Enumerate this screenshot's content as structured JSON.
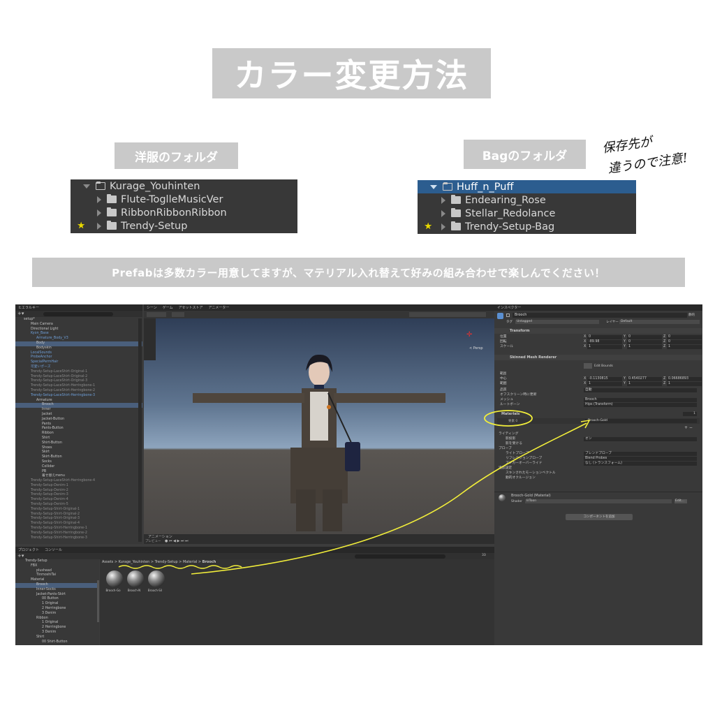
{
  "title": "カラー変更方法",
  "left_folder_label": "洋服のフォルダ",
  "right_folder_label": "Bagのフォルダ",
  "hand_note": [
    "保存先が",
    "違うので注意!"
  ],
  "left_folder": {
    "root": "Kurage_Youhinten",
    "children": [
      "Flute-ToglleMusicVer",
      "RibbonRibbonRibbon",
      "Trendy-Setup"
    ]
  },
  "right_folder": {
    "root": "Huff_n_Puff",
    "children": [
      "Endearing_Rose",
      "Stellar_Redolance",
      "Trendy-Setup-Bag"
    ]
  },
  "banner": "Prefabは多数カラー用意してますが、マテリアル入れ替えて好みの組み合わせで楽しんでください！",
  "unity": {
    "hierarchy_tab": "ヒエラルキー",
    "scene_tabs": [
      "シーン",
      "ゲーム",
      "アセットストア",
      "アニメーター"
    ],
    "inspector_tab": "インスペクター",
    "hierarchy": [
      {
        "t": "setup*",
        "c": ""
      },
      {
        "t": "Main Camera",
        "c": ""
      },
      {
        "t": "Directional Light",
        "c": ""
      },
      {
        "t": "Kyon_Base",
        "c": "blue"
      },
      {
        "t": "Armature_Body_V3",
        "c": "blue"
      },
      {
        "t": "Body",
        "c": "sel"
      },
      {
        "t": "Bodyskin",
        "c": ""
      },
      {
        "t": "LocalSounds",
        "c": "blue"
      },
      {
        "t": "ProbeAnchor",
        "c": "blue"
      },
      {
        "t": "SpecialPermHair",
        "c": "blue"
      },
      {
        "t": "可愛いポーズ",
        "c": "blue"
      },
      {
        "t": "Trendy-Setup-LaceShirt-Original-1",
        "c": "dim"
      },
      {
        "t": "Trendy-Setup-LaceShirt-Original-2",
        "c": "dim"
      },
      {
        "t": "Trendy-Setup-LaceShirt-Original-3",
        "c": "dim"
      },
      {
        "t": "Trendy-Setup-LaceShirt-Herringbone-1",
        "c": "dim"
      },
      {
        "t": "Trendy-Setup-LaceShirt-Herringbone-2",
        "c": "dim"
      },
      {
        "t": "Trendy-Setup-LaceShirt-Herringbone-3",
        "c": "blue"
      },
      {
        "t": "Armature",
        "c": ""
      },
      {
        "t": "Brooch",
        "c": "sel"
      },
      {
        "t": "Inner",
        "c": ""
      },
      {
        "t": "Jacket",
        "c": ""
      },
      {
        "t": "Jacket-Button",
        "c": ""
      },
      {
        "t": "Pants",
        "c": ""
      },
      {
        "t": "Pants-Button",
        "c": ""
      },
      {
        "t": "Ribbon",
        "c": ""
      },
      {
        "t": "Shirt",
        "c": ""
      },
      {
        "t": "Shirt-Button",
        "c": ""
      },
      {
        "t": "Shoes",
        "c": ""
      },
      {
        "t": "Skirt",
        "c": ""
      },
      {
        "t": "Skirt-Button",
        "c": ""
      },
      {
        "t": "Socks",
        "c": ""
      },
      {
        "t": "Collider",
        "c": ""
      },
      {
        "t": "PB",
        "c": ""
      },
      {
        "t": "着せ替えmenu",
        "c": ""
      },
      {
        "t": "Trendy-Setup-LaceShirt-Herringbone-4",
        "c": "dim"
      },
      {
        "t": "Trendy-Setup-Denim-1",
        "c": "dim"
      },
      {
        "t": "Trendy-Setup-Denim-2",
        "c": "dim"
      },
      {
        "t": "Trendy-Setup-Denim-3",
        "c": "dim"
      },
      {
        "t": "Trendy-Setup-Denim-4",
        "c": "dim"
      },
      {
        "t": "Trendy-Setup-Denim-5",
        "c": "dim"
      },
      {
        "t": "Trendy-Setup-Shirt-Original-1",
        "c": "dim"
      },
      {
        "t": "Trendy-Setup-Shirt-Original-2",
        "c": "dim"
      },
      {
        "t": "Trendy-Setup-Shirt-Original-3",
        "c": "dim"
      },
      {
        "t": "Trendy-Setup-Shirt-Original-4",
        "c": "dim"
      },
      {
        "t": "Trendy-Setup-Shirt-Herringbone-1",
        "c": "dim"
      },
      {
        "t": "Trendy-Setup-Shirt-Herringbone-2",
        "c": "dim"
      },
      {
        "t": "Trendy-Setup-Shirt-Herringbone-3",
        "c": "dim"
      }
    ],
    "project_tabs": [
      "プロジェクト",
      "コンソール"
    ],
    "project_tree": [
      {
        "t": "Trendy-Setup",
        "d": 0
      },
      {
        "t": "FBX",
        "d": 1
      },
      {
        "t": "plushead",
        "d": 2
      },
      {
        "t": "TinmoshiTai",
        "d": 2
      },
      {
        "t": "Material",
        "d": 1
      },
      {
        "t": "Brooch",
        "d": 2,
        "sel": true
      },
      {
        "t": "Inner-Socks",
        "d": 2
      },
      {
        "t": "Jacket-Pants-Skirt",
        "d": 2
      },
      {
        "t": "00 Button",
        "d": 3
      },
      {
        "t": "1 Original",
        "d": 3
      },
      {
        "t": "2 Herringbone",
        "d": 3
      },
      {
        "t": "3 Denim",
        "d": 3
      },
      {
        "t": "Ribbon",
        "d": 2
      },
      {
        "t": "1 Original",
        "d": 3
      },
      {
        "t": "2 Herringbone",
        "d": 3
      },
      {
        "t": "3 Denim",
        "d": 3
      },
      {
        "t": "Shirt",
        "d": 2
      },
      {
        "t": "00 Shirt-Button",
        "d": 3
      }
    ],
    "breadcrumb": [
      "Assets",
      "Kurage_Youhinten",
      "Trendy-Setup",
      "Material",
      "Brooch"
    ],
    "assets": [
      "Brooch-Go",
      "Brooch-N",
      "Brooch-Sil"
    ],
    "inspector": {
      "name": "Brooch",
      "tag_label": "タグ",
      "tag": "Untagged",
      "layer_label": "レイヤー",
      "layer": "Default",
      "static": "静的",
      "transform": "Transform",
      "position_label": "位置",
      "rotation_label": "回転",
      "scale_label": "スケール",
      "position": [
        "0",
        "0",
        "0"
      ],
      "rotation": [
        "-89.98",
        "0",
        "0"
      ],
      "scale": [
        "1",
        "1",
        "1"
      ],
      "smr": "Skinned Mesh Renderer",
      "edit_bounds": "Edit Bounds",
      "bounds_label": "範囲",
      "center_label": "中心",
      "extent_label": "範囲",
      "center": [
        "-0.1130815",
        "0.4540277",
        "0.06686893"
      ],
      "extent": [
        "1",
        "1",
        "1"
      ],
      "quality_label": "品質",
      "quality": "自動",
      "offscreen_label": "オフスクリーン時に更新",
      "mesh_label": "メッシュ",
      "mesh": "Brooch",
      "rootbone_label": "ルートボーン",
      "rootbone": "Hips (Transform)",
      "materials_label": "Materials",
      "materials_size": "1",
      "element_label": "要素 0",
      "element_value": "Brooch-Gold",
      "lighting": "ライティング",
      "cast_label": "影投影",
      "cast": "オン",
      "receive_label": "影を受ける",
      "probes": "プローブ",
      "lightprobe_label": "ライトプローブ",
      "lightprobe": "ブレンドプローブ",
      "reflection_label": "リフレクションプローブ",
      "reflection": "Blend Probes",
      "anchor_label": "アンカーオーバーライド",
      "anchor": "なし (トランスフォーム)",
      "additional": "追加設定",
      "skinned_motion_label": "スキンされたモーションベクトル",
      "dynamic_occ_label": "動的オクルージョン",
      "material_name": "Brooch-Gold (Material)",
      "shader_label": "Shader",
      "shader": "lilToon",
      "edit_label": "Edit...",
      "add_component": "コンポーネントを追加"
    },
    "animation_tab": "アニメーション",
    "preview_label": "プレビュー",
    "persp": "< Persp",
    "search_count": "33"
  }
}
